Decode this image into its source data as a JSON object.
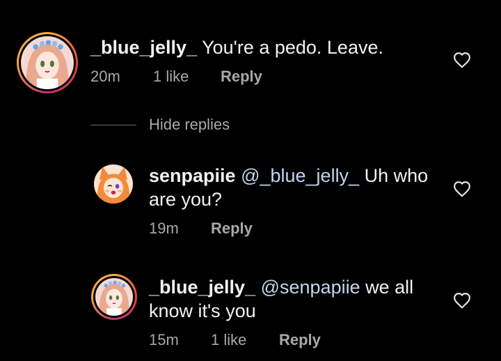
{
  "comments": [
    {
      "username": "_blue_jelly_",
      "mention": "",
      "text": " You're a pedo. Leave.",
      "time": "20m",
      "likes": "1 like",
      "reply": "Reply",
      "avatar": "avatar-pink-anime-girl"
    },
    {
      "username": "senpapiie",
      "mention": "@_blue_jelly_",
      "text": " Uh who are you?",
      "time": "19m",
      "likes": "",
      "reply": "Reply",
      "avatar": "avatar-orange-fox-girl"
    },
    {
      "username": "_blue_jelly_",
      "mention": "@senpapiie",
      "text": " we all know it's you",
      "time": "15m",
      "likes": "1 like",
      "reply": "Reply",
      "avatar": "avatar-pink-anime-girl"
    }
  ],
  "hide_replies": "Hide replies",
  "icons": {
    "like": "heart-outline-icon"
  },
  "colors": {
    "background": "#000000",
    "text": "#f2f2f2",
    "meta": "#a8a8a8",
    "mention": "#c3d5f0"
  }
}
